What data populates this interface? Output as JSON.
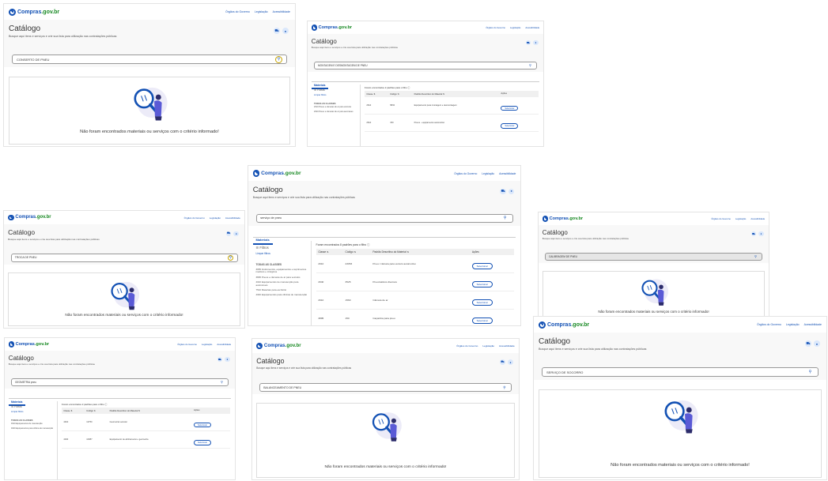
{
  "app": {
    "logo_prefix": "Compras",
    "logo_suffix": ".gov.br",
    "links": [
      "Órgãos do Governo",
      "Legislação",
      "Acessibilidade"
    ]
  },
  "page": {
    "title": "Catálogo",
    "subtitle": "Busque aqui itens e serviços e crie sua lista para utilização nas contratações públicas"
  },
  "empty_message": "Não foram encontrados materiais ou serviços com o critério informado!",
  "results_label_tab": "Materiais",
  "filters": {
    "label": "Filtros",
    "clear": "Limpar filtros",
    "class_head": "TODAS AS CLASSES"
  },
  "table_headers": [
    "Classe",
    "Código",
    "Padrão Descritivo do Material",
    "Ações"
  ],
  "select_label": "Selecionar",
  "screens": [
    {
      "id": "s1",
      "query": "CONSERTO DE PNEU"
    },
    {
      "id": "s2",
      "query": "MONTAGEM E DESMONTAGEM DE PNEU",
      "found": "Foram encontrados 2 padrões para o filtro",
      "classes": [
        "2610 Pneus e câmaras de ar para veículos",
        "2620 Pneus e câmaras de ar para aeronaves"
      ],
      "rows": [
        [
          "2610",
          "5832",
          "Equipamento para montagem e desmontagem"
        ],
        [
          "2610",
          "150",
          "Pneus - equipamento automotivo"
        ]
      ]
    },
    {
      "id": "s3",
      "query": "serviço de pneu",
      "found": "Foram encontrados 8 padrões para o filtro",
      "classes": [
        "3655 Instrumentos, equipamentos e suprimentos médicos e cirúrgicos",
        "3895 Pneus e câmaras de ar para veículos",
        "4910 Equipamentos de manutenção para automóveis",
        "7510 Materiais para escritório",
        "4940 Equipamentos para oficinas de manutenção"
      ],
      "rows": [
        [
          "2610",
          "23053",
          "Pneu / câmara para veículo automotivo"
        ],
        [
          "2640",
          "3525",
          "Pneumáticos diversos"
        ],
        [
          "2610",
          "1560",
          "Câmara de ar"
        ],
        [
          "3895",
          "150",
          "Caçamba para pneu"
        ],
        [
          "4910",
          "2160",
          "Balança pneumática"
        ],
        [
          "4940",
          "8890",
          "Reparo - equipamento de oficina"
        ]
      ]
    },
    {
      "id": "s4",
      "query": "TROCA DE PNEU"
    },
    {
      "id": "s5",
      "query": "CALIBRAGEM DE PNEU"
    },
    {
      "id": "s6",
      "query": "GEOMETRIA pneu",
      "found": "Foram encontrados 2 padrões para o filtro",
      "classes": [
        "4910 Equipamentos de manutenção",
        "4940 Equipamentos para oficina de manutenção"
      ],
      "rows": [
        [
          "4910",
          "12750",
          "Geometria veicular"
        ],
        [
          "4940",
          "10387",
          "Equipamento de alinhamento e geometria"
        ]
      ]
    },
    {
      "id": "s7",
      "query": "BALANCEAMENTO DE PNEU"
    },
    {
      "id": "s8",
      "query": "SERVIÇO DE SOCORRO"
    }
  ]
}
